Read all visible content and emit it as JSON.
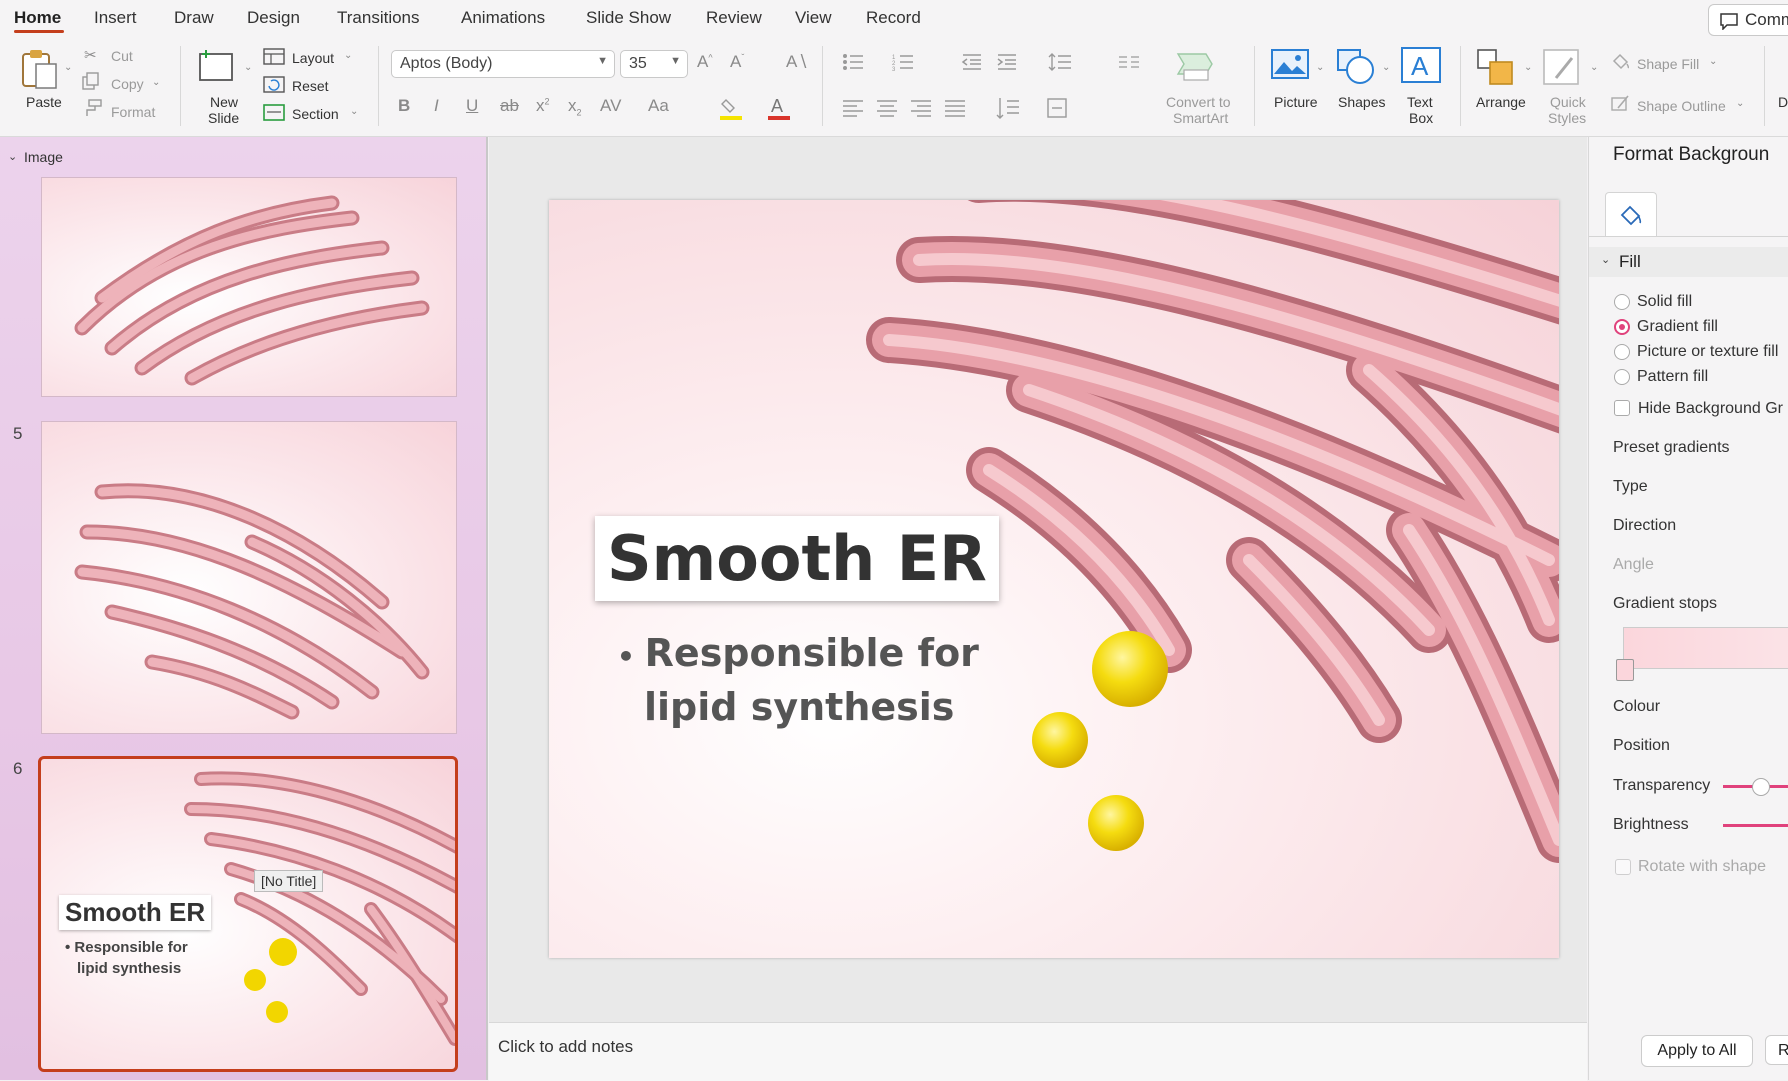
{
  "tabs": [
    "Home",
    "Insert",
    "Draw",
    "Design",
    "Transitions",
    "Animations",
    "Slide Show",
    "Review",
    "View",
    "Record"
  ],
  "comments_label": "Comm",
  "ribbon": {
    "paste": "Paste",
    "cut": "Cut",
    "copy": "Copy",
    "format": "Format",
    "new_slide_1": "New",
    "new_slide_2": "Slide",
    "layout": "Layout",
    "reset": "Reset",
    "section": "Section",
    "font_name": "Aptos (Body)",
    "font_size": "35",
    "convert_1": "Convert to",
    "convert_2": "SmartArt",
    "picture": "Picture",
    "shapes": "Shapes",
    "textbox_1": "Text",
    "textbox_2": "Box",
    "arrange": "Arrange",
    "quick_styles_1": "Quick",
    "quick_styles_2": "Styles",
    "shape_fill": "Shape Fill",
    "shape_outline": "Shape Outline",
    "overflow": "D"
  },
  "thumbs": {
    "section_label": "Image",
    "slide5_num": "5",
    "slide6_num": "6",
    "slide6_title": "Smooth ER",
    "slide6_bullet_1": "Responsible for",
    "slide6_bullet_2": "lipid synthesis",
    "tooltip": "[No Title]"
  },
  "slide": {
    "title": "Smooth ER",
    "bullet_line1": "Responsible for",
    "bullet_line2": "lipid synthesis"
  },
  "notes_placeholder": "Click to add notes",
  "pane": {
    "title": "Format Backgroun",
    "fill_header": "Fill",
    "solid_fill": "Solid fill",
    "gradient_fill": "Gradient fill",
    "picture_fill": "Picture or texture fill",
    "pattern_fill": "Pattern fill",
    "hide_bg": "Hide Background Gr",
    "preset_gradients": "Preset gradients",
    "type": "Type",
    "direction": "Direction",
    "angle": "Angle",
    "gradient_stops": "Gradient stops",
    "colour": "Colour",
    "position": "Position",
    "transparency": "Transparency",
    "brightness": "Brightness",
    "rotate": "Rotate with shape",
    "apply_all": "Apply to All",
    "reset_short": "R"
  },
  "colors": {
    "accent_tab": "#c43e1c",
    "selected_radio": "#e0427c",
    "er_pink": "#e7a1a8",
    "sphere_yellow": "#f2d600"
  }
}
